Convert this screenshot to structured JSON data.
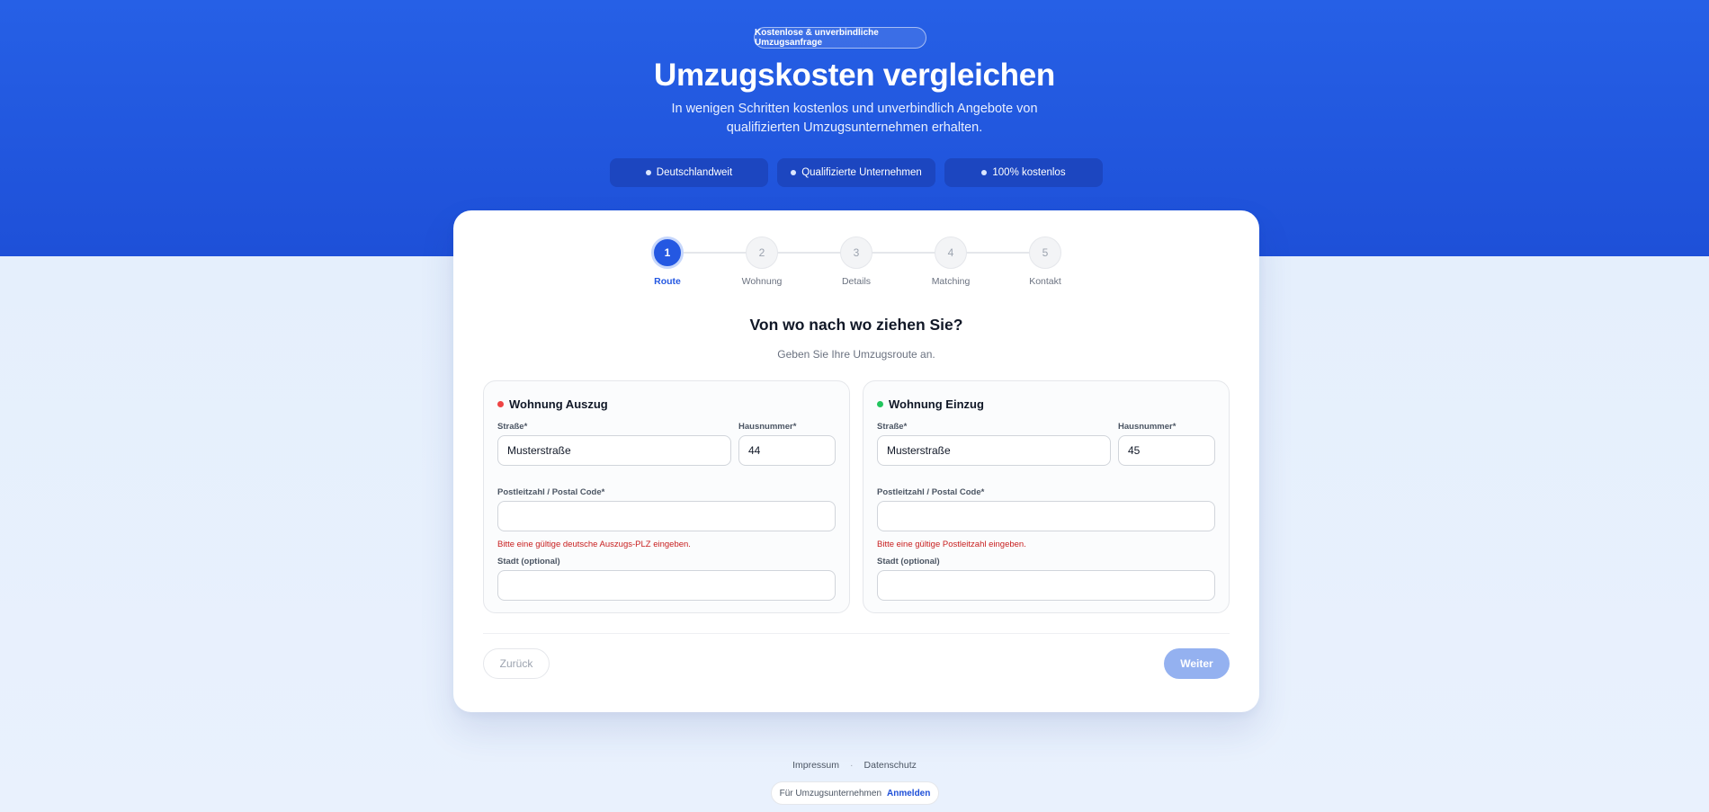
{
  "hero": {
    "badge": "Kostenlose & unverbindliche Umzugsanfrage",
    "title": "Umzugskosten vergleichen",
    "subtitle": "In wenigen Schritten kostenlos und unverbindlich Angebote von qualifizierten Umzugsunternehmen erhalten.",
    "pills": [
      "Deutschlandweit",
      "Qualifizierte Unternehmen",
      "100% kostenlos"
    ]
  },
  "stepper": {
    "current": 1,
    "steps": [
      {
        "number": "1",
        "label": "Route"
      },
      {
        "number": "2",
        "label": "Wohnung"
      },
      {
        "number": "3",
        "label": "Details"
      },
      {
        "number": "4",
        "label": "Matching"
      },
      {
        "number": "5",
        "label": "Kontakt"
      }
    ]
  },
  "form": {
    "title": "Von wo nach wo ziehen Sie?",
    "subtitle": "Geben Sie Ihre Umzugsroute an.",
    "auszug": {
      "title": "Wohnung Auszug",
      "street_label": "Straße*",
      "street_value": "Musterstraße",
      "number_label": "Hausnummer*",
      "number_value": "44",
      "postal_label": "Postleitzahl / Postal Code*",
      "postal_value": "",
      "postal_error": "Bitte eine gültige deutsche Auszugs-PLZ eingeben.",
      "city_label": "Stadt (optional)",
      "city_value": ""
    },
    "einzug": {
      "title": "Wohnung Einzug",
      "street_label": "Straße*",
      "street_value": "Musterstraße",
      "number_label": "Hausnummer*",
      "number_value": "45",
      "postal_label": "Postleitzahl / Postal Code*",
      "postal_value": "",
      "postal_error": "Bitte eine gültige Postleitzahl eingeben.",
      "city_label": "Stadt (optional)",
      "city_value": ""
    },
    "back_label": "Zurück",
    "next_label": "Weiter"
  },
  "footer": {
    "impressum": "Impressum",
    "separator": "·",
    "datenschutz": "Datenschutz",
    "company_text": "Für Umzugsunternehmen",
    "company_link": "Anmelden"
  },
  "colors": {
    "primary": "#2458e2",
    "auszug_dot": "#ef4444",
    "einzug_dot": "#22c55e",
    "error": "#c81e1e"
  },
  "icons": [
    "bullet-dot-icon",
    "status-dot-icon"
  ]
}
